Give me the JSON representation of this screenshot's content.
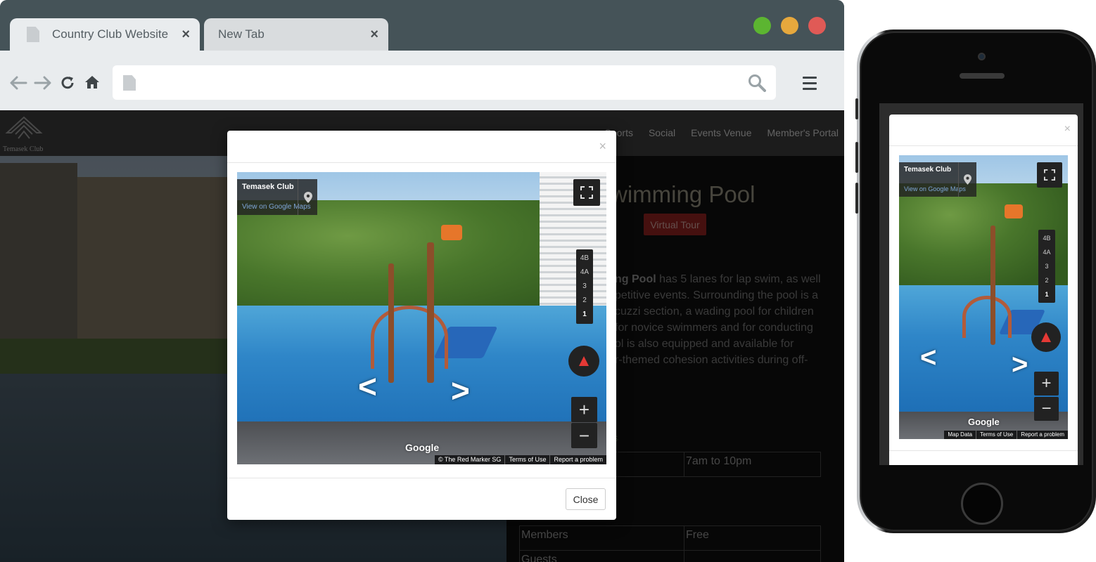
{
  "browser": {
    "tabs": [
      {
        "label": "Country Club Website",
        "close": "×"
      },
      {
        "label": "New Tab",
        "close": "×"
      }
    ],
    "window_dots": [
      "#5cb531",
      "#e6a83d",
      "#e05a56"
    ],
    "url": ""
  },
  "site": {
    "brand": "Temasek Club",
    "nav": [
      "Sports",
      "Social",
      "Events Venue",
      "Member's Portal"
    ],
    "page_title": "wimming Pool",
    "virtual_tour": "Virtual Tour",
    "paragraph": {
      "bold_fragment": "ng Pool",
      "lines": [
        " has 5 lanes for lap swim, as well",
        "petitive events.  Surrounding the pool is a",
        "cuzzi section, a wading pool for children",
        "for novice swimmers and for conducting",
        "ol is also equipped and available for",
        "r-themed cohesion activities during off-"
      ]
    },
    "link_fragment": "s",
    "hours_table": [
      [
        "",
        "7am to 10pm"
      ]
    ],
    "fees_table": [
      [
        "Members",
        "Free"
      ],
      [
        "Guests",
        ""
      ]
    ]
  },
  "modal": {
    "close_x": "×",
    "close_button": "Close",
    "streetview": {
      "place_name": "Temasek Club",
      "maps_link": "View on Google Maps",
      "floors": [
        "4B",
        "4A",
        "3",
        "2",
        "1"
      ],
      "selected_floor": "1",
      "zoom_in": "+",
      "zoom_out": "−",
      "google": "Google",
      "attribution": [
        "© The Red Marker SG",
        "Terms of Use",
        "Report a problem"
      ],
      "arrow_left": "<",
      "arrow_right": ">"
    }
  },
  "phone": {
    "close_x": "×",
    "streetview": {
      "place_name": "Temasek Club",
      "maps_link": "View on Google Maps",
      "floors": [
        "4B",
        "4A",
        "3",
        "2",
        "1"
      ],
      "selected_floor": "1",
      "zoom_in": "+",
      "zoom_out": "−",
      "google": "Google",
      "attribution": [
        "Map Data",
        "Terms of Use",
        "Report a problem"
      ],
      "arrow_left": "<",
      "arrow_right": ">"
    }
  }
}
